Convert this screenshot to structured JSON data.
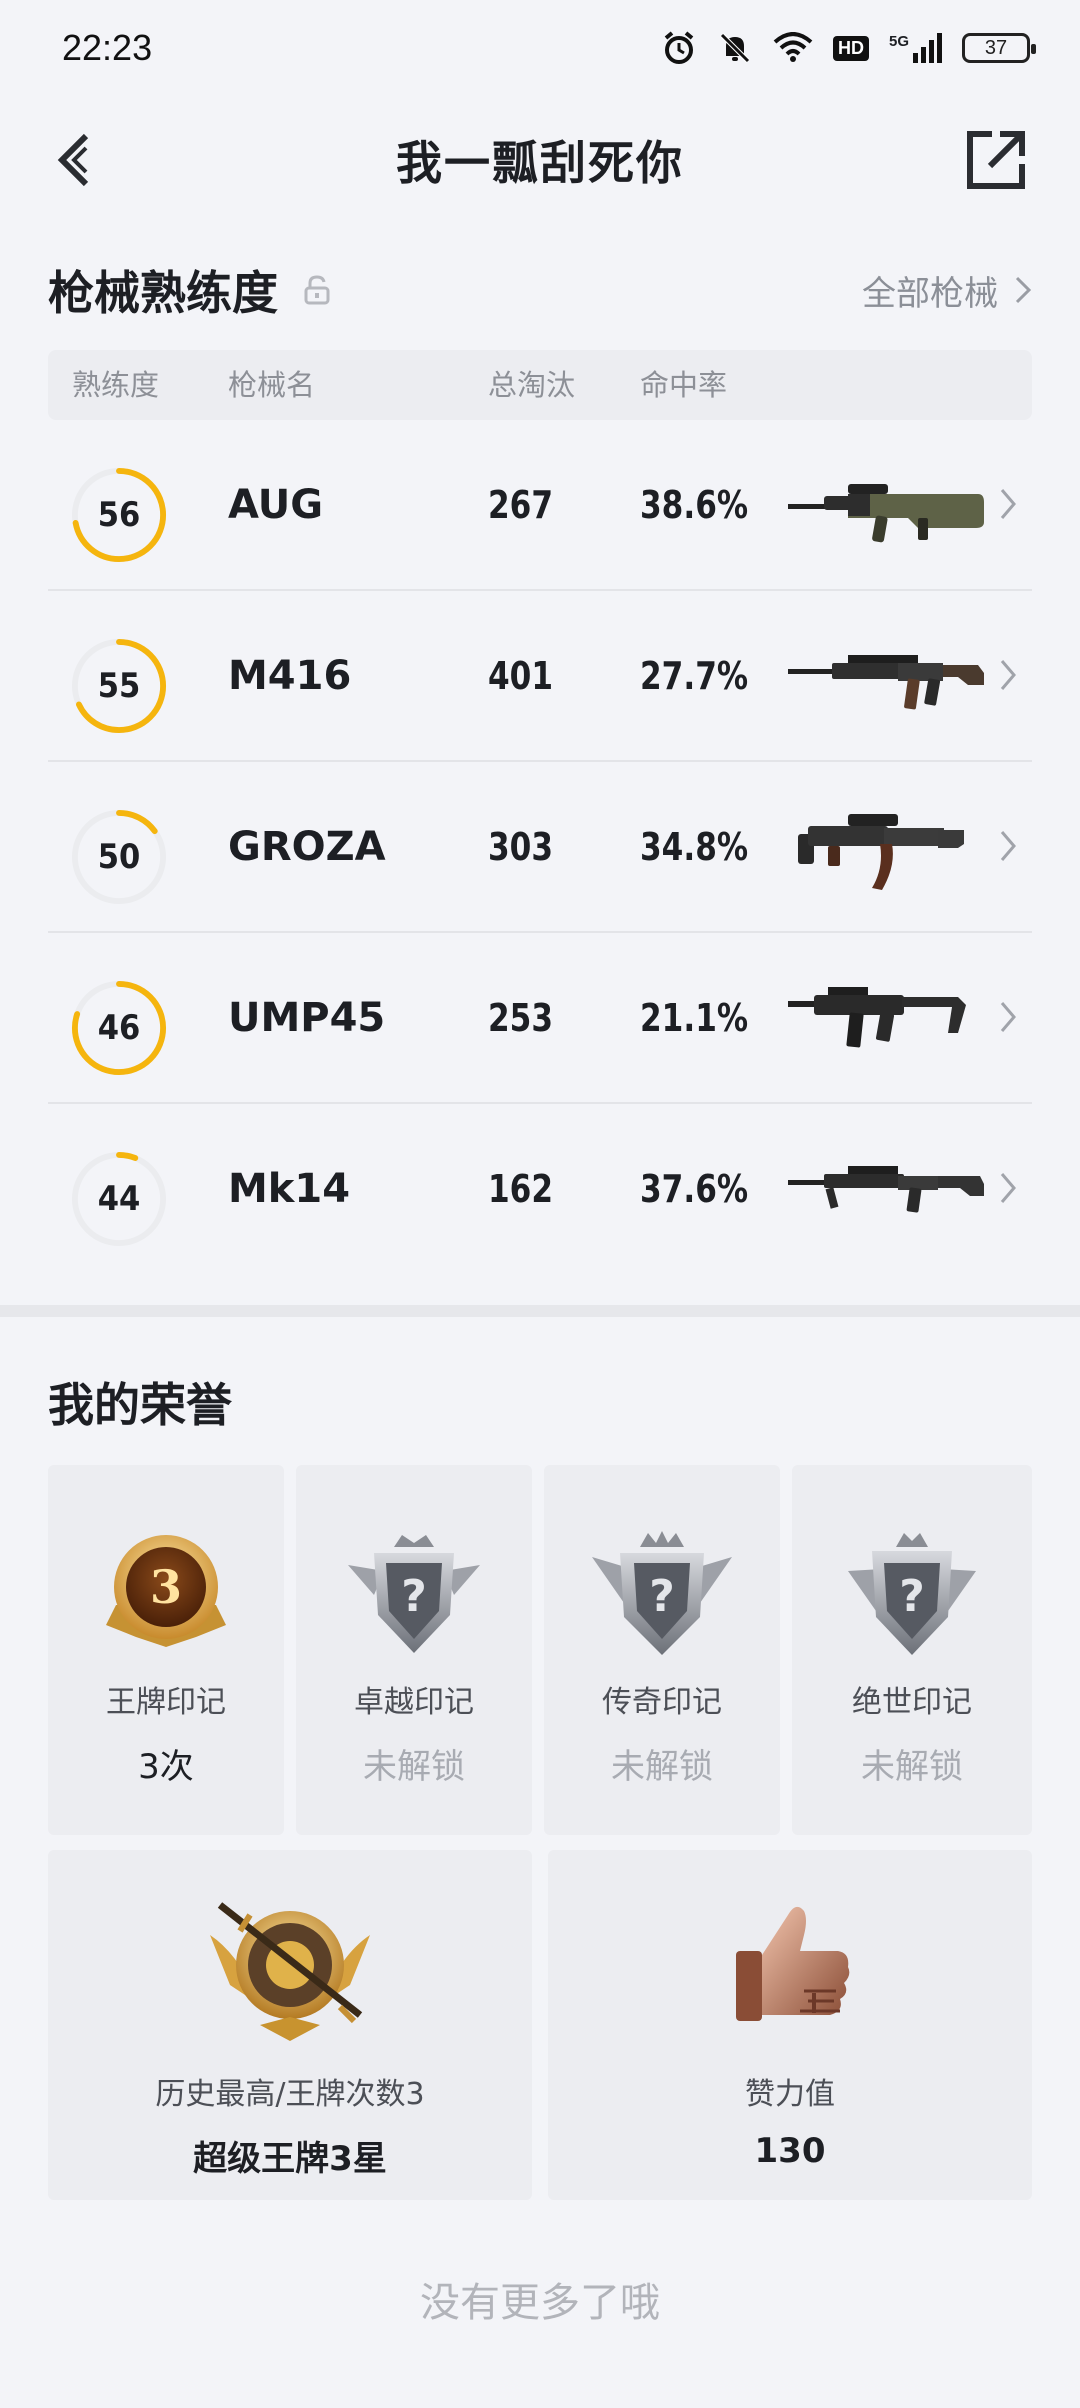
{
  "status": {
    "time": "22:23",
    "battery": "37",
    "network": "5G",
    "hd": "HD"
  },
  "nav": {
    "title": "我一瓢刮死你"
  },
  "weapons": {
    "title": "枪械熟练度",
    "all_link": "全部枪械",
    "columns": {
      "proficiency": "熟练度",
      "name": "枪械名",
      "kills": "总淘汰",
      "accuracy": "命中率"
    },
    "rows": [
      {
        "level": "56",
        "progress": 0.72,
        "name": "AUG",
        "kills": "267",
        "accuracy": "38.6%"
      },
      {
        "level": "55",
        "progress": 0.68,
        "name": "M416",
        "kills": "401",
        "accuracy": "27.7%"
      },
      {
        "level": "50",
        "progress": 0.15,
        "name": "GROZA",
        "kills": "303",
        "accuracy": "34.8%"
      },
      {
        "level": "46",
        "progress": 0.8,
        "name": "UMP45",
        "kills": "253",
        "accuracy": "21.1%"
      },
      {
        "level": "44",
        "progress": 0.06,
        "name": "Mk14",
        "kills": "162",
        "accuracy": "37.6%"
      }
    ]
  },
  "honors": {
    "title": "我的荣誉",
    "badges": [
      {
        "label": "王牌印记",
        "value": "3次",
        "locked": false,
        "icon": "ace-badge-icon",
        "badge_number": "3"
      },
      {
        "label": "卓越印记",
        "value": "未解锁",
        "locked": true,
        "icon": "locked-badge-icon"
      },
      {
        "label": "传奇印记",
        "value": "未解锁",
        "locked": true,
        "icon": "locked-badge-icon"
      },
      {
        "label": "绝世印记",
        "value": "未解锁",
        "locked": true,
        "icon": "locked-badge-icon"
      }
    ],
    "stats": [
      {
        "label": "历史最高/王牌次数3",
        "value": "超级王牌3星",
        "icon": "super-ace-emblem-icon"
      },
      {
        "label": "赞力值",
        "value": "130",
        "icon": "thumbs-up-icon"
      }
    ]
  },
  "footer": {
    "note": "没有更多了哦"
  },
  "colors": {
    "accent": "#f5b50e",
    "ring_track": "#ebecef",
    "muted": "#8b8f97",
    "locked": "#a8abb2"
  }
}
